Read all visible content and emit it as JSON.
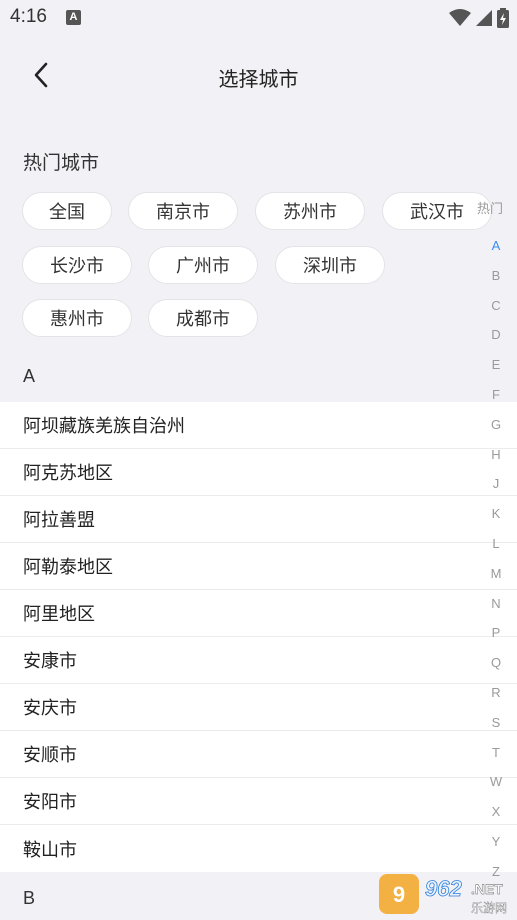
{
  "status_bar": {
    "time": "4:16",
    "notification_letter": "A"
  },
  "header": {
    "title": "选择城市",
    "back_icon": "chevron-left-icon"
  },
  "hot_section": {
    "label": "热门城市",
    "cities": [
      "全国",
      "南京市",
      "苏州市",
      "武汉市",
      "长沙市",
      "广州市",
      "深圳市",
      "惠州市",
      "成都市"
    ]
  },
  "groups": [
    {
      "letter": "A",
      "cities": [
        "阿坝藏族羌族自治州",
        "阿克苏地区",
        "阿拉善盟",
        "阿勒泰地区",
        "阿里地区",
        "安康市",
        "安庆市",
        "安顺市",
        "安阳市",
        "鞍山市"
      ]
    },
    {
      "letter": "B",
      "cities": []
    }
  ],
  "index_bar": {
    "hot_label": "热门",
    "letters": [
      "A",
      "B",
      "C",
      "D",
      "E",
      "F",
      "G",
      "H",
      "J",
      "K",
      "L",
      "M",
      "N",
      "P",
      "Q",
      "R",
      "S",
      "T",
      "W",
      "X",
      "Y",
      "Z"
    ],
    "active": "A",
    "active_color": "#3c8df3"
  },
  "watermark": {
    "number": "962",
    "suffix": ".NET",
    "caption": "乐游网"
  }
}
